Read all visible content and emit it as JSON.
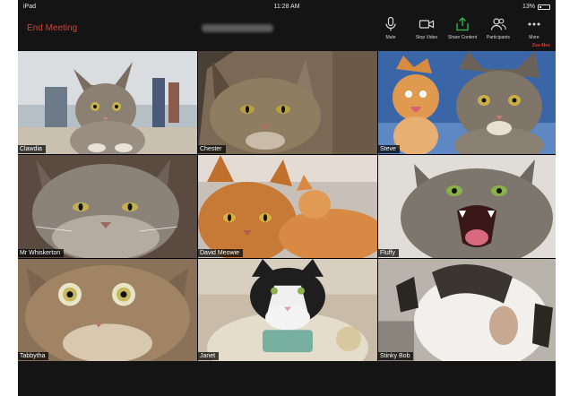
{
  "status_bar": {
    "device": "iPad",
    "time": "11:28 AM",
    "battery": "13%"
  },
  "meeting": {
    "end_label": "End Meeting"
  },
  "toolbar": {
    "mute_label": "Mute",
    "stop_video_label": "Stop Video",
    "share_label": "Share Content",
    "participants_label": "Participants",
    "more_label": "More",
    "badge": "Zoo Mee"
  },
  "participants": [
    {
      "name": "Clawdia"
    },
    {
      "name": "Chester"
    },
    {
      "name": "Steve"
    },
    {
      "name": "Mr Whiskerton"
    },
    {
      "name": "David Meowie"
    },
    {
      "name": "Fluffy"
    },
    {
      "name": "Tabbytha"
    },
    {
      "name": "Janet"
    },
    {
      "name": "Stinky Bob"
    }
  ],
  "colors": {
    "end_meeting": "#e33b2e",
    "share_icon": "#2fbf4d",
    "background": "#141414"
  }
}
